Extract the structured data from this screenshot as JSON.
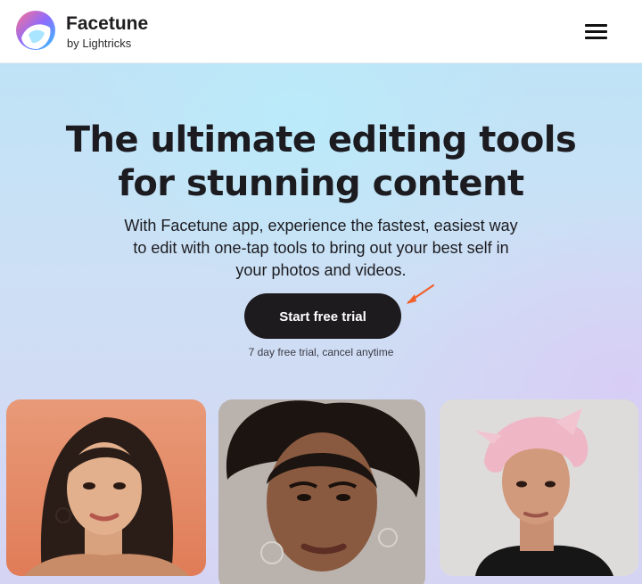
{
  "header": {
    "brand_name": "Facetune",
    "brand_sub": "by Lightricks",
    "logo_icon": "facetune-logo-icon",
    "menu_icon": "hamburger-menu-icon"
  },
  "hero": {
    "headline_line1": "The ultimate editing tools",
    "headline_line2": "for stunning content",
    "subtext": "With Facetune app, experience the fastest, easiest way to edit with one-tap tools to bring out your best self in your photos and videos.",
    "cta_label": "Start free trial",
    "trial_note": "7 day free trial, cancel anytime",
    "arrow_icon": "arrow-pointer-icon"
  },
  "gallery": [
    {
      "name": "portrait-photo-1"
    },
    {
      "name": "portrait-photo-2"
    },
    {
      "name": "portrait-photo-3"
    }
  ],
  "colors": {
    "cta_background": "#1e1b1f",
    "arrow": "#f0612c",
    "headline": "#1c1b20"
  }
}
